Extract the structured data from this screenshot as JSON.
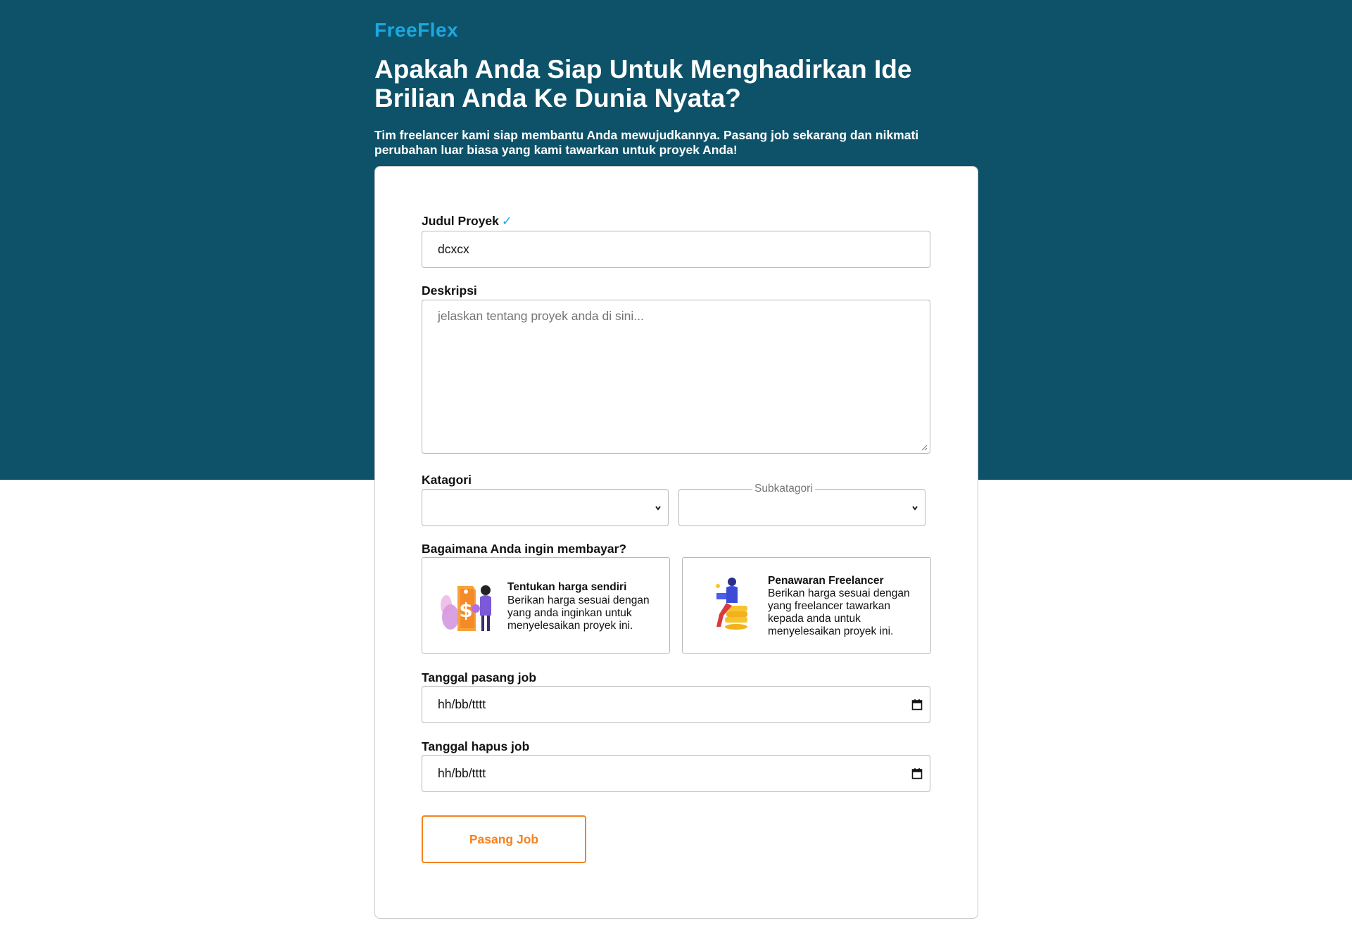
{
  "brand": {
    "name": "FreeFlex",
    "color": "#1ba8e0"
  },
  "hero": {
    "headline": "Apakah Anda Siap Untuk Menghadirkan Ide Brilian Anda Ke Dunia Nyata?",
    "subline": "Tim freelancer kami siap membantu Anda mewujudkannya. Pasang job sekarang dan nikmati perubahan luar biasa yang kami tawarkan untuk proyek Anda!",
    "background": "#0e5269"
  },
  "form": {
    "title_field": {
      "label": "Judul Proyek",
      "valid_mark": "✓",
      "value": "dcxcx"
    },
    "description_field": {
      "label": "Deskripsi",
      "placeholder": "jelaskan tentang proyek anda di sini...",
      "value": ""
    },
    "category_field": {
      "label": "Katagori",
      "selected": ""
    },
    "subcategory_field": {
      "label": "Subkatagori",
      "selected": ""
    },
    "payment": {
      "label": "Bagaimana Anda ingin membayar?",
      "options": [
        {
          "title": "Tentukan harga sendiri",
          "description": "Berikan harga sesuai dengan yang anda inginkan untuk menyelesaikan proyek ini.",
          "icon": "price-tag-illustration"
        },
        {
          "title": "Penawaran Freelancer",
          "description": "Berikan harga sesuai dengan yang freelancer tawarkan kepada anda untuk menyelesaikan proyek ini.",
          "icon": "freelancer-coins-illustration"
        }
      ]
    },
    "post_date": {
      "label": "Tanggal pasang job",
      "value": "hh/bb/tttt",
      "icon": "calendar-icon"
    },
    "delete_date": {
      "label": "Tanggal hapus job",
      "value": "hh/bb/tttt",
      "icon": "calendar-icon"
    },
    "submit_label": "Pasang Job",
    "accent_color": "#f58220"
  }
}
